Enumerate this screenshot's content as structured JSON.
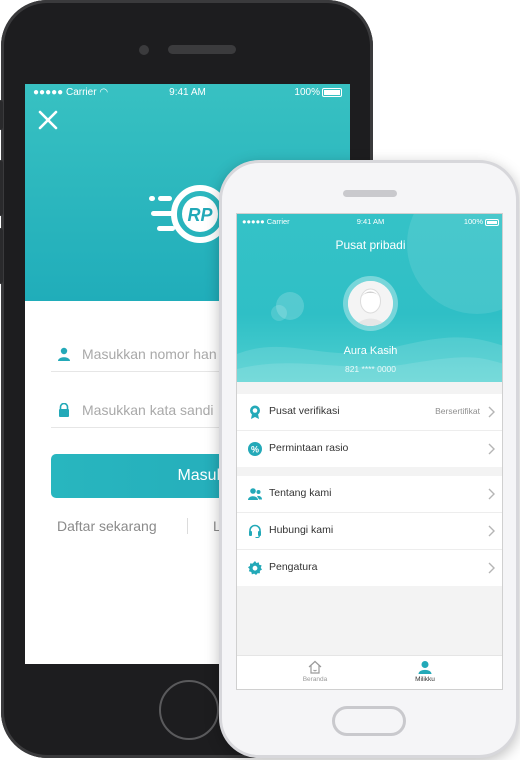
{
  "colors": {
    "teal": "#2fbac2",
    "teal_dark": "#1fa6b6",
    "text": "#333333",
    "muted": "#8f8f8f"
  },
  "back_phone": {
    "status": {
      "carrier": "Carrier",
      "time": "9:41 AM",
      "battery": "100%"
    },
    "close_icon": "close-icon",
    "logo_text": "RP",
    "phone_field": {
      "icon": "user-icon",
      "placeholder": "Masukkan nomor han"
    },
    "password_field": {
      "icon": "lock-icon",
      "placeholder": "Masukkan kata sandi"
    },
    "login_button": "Masuk",
    "register_link": "Daftar sekarang",
    "other_link": "L"
  },
  "front_phone": {
    "status": {
      "carrier": "Carrier",
      "time": "9:41 AM",
      "battery": "100%"
    },
    "title": "Pusat pribadi",
    "user": {
      "name": "Aura Kasih",
      "phone": "821 **** 0000"
    },
    "menu_group_1": [
      {
        "icon": "badge-icon",
        "label": "Pusat verifikasi",
        "value": "Bersertifikat"
      },
      {
        "icon": "percent-icon",
        "label": "Permintaan rasio",
        "value": ""
      }
    ],
    "menu_group_2": [
      {
        "icon": "people-icon",
        "label": "Tentang kami",
        "value": ""
      },
      {
        "icon": "headset-icon",
        "label": "Hubungi kami",
        "value": ""
      },
      {
        "icon": "gear-icon",
        "label": "Pengatura",
        "value": ""
      }
    ],
    "tabs": [
      {
        "icon": "home-icon",
        "label": "Beranda",
        "active": false
      },
      {
        "icon": "user-icon",
        "label": "Milikku",
        "active": true
      }
    ]
  }
}
